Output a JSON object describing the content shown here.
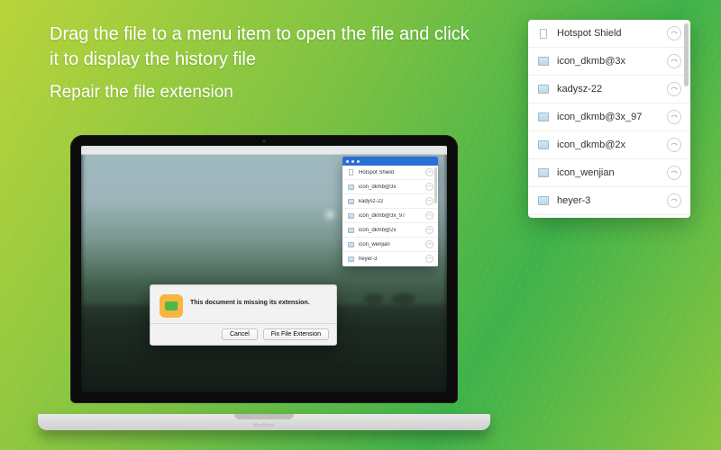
{
  "headline": "Drag the file to a menu item to open the file and click it to display the history file",
  "subheadline": "Repair the file extension",
  "dialog": {
    "message": "This document is missing its extension.",
    "cancel_label": "Cancel",
    "fix_label": "Fix File Extension"
  },
  "files": [
    {
      "name": "Hotspot Shield",
      "type": "txt"
    },
    {
      "name": "icon_dkmb@3x",
      "type": "img"
    },
    {
      "name": "kadysz-22",
      "type": "img"
    },
    {
      "name": "icon_dkmb@3x_97",
      "type": "img"
    },
    {
      "name": "icon_dkmb@2x",
      "type": "img"
    },
    {
      "name": "icon_wenjian",
      "type": "img"
    },
    {
      "name": "heyer-3",
      "type": "img"
    }
  ],
  "laptop_brand": "MacBook"
}
